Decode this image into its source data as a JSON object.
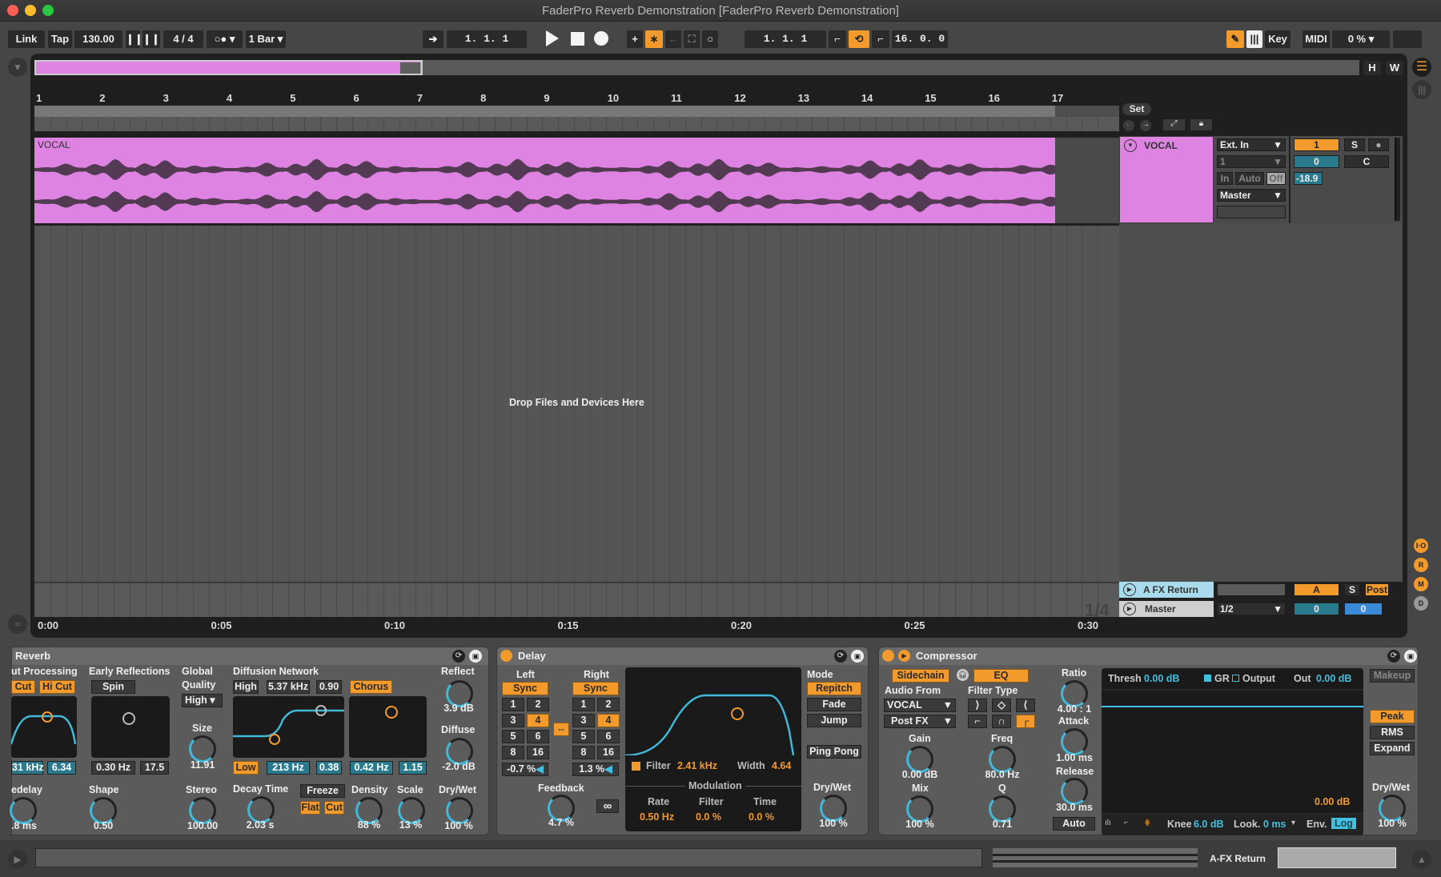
{
  "window": {
    "title": "FaderPro Reverb Demonstration  [FaderPro Reverb Demonstration]"
  },
  "transport": {
    "link": "Link",
    "tap": "Tap",
    "tempo": "130.00",
    "time_signature": "4 / 4",
    "quantize": "1 Bar",
    "metronome_icon": "metronome-icon",
    "position": "1.  1.  1",
    "loop_start": "1.  1.  1",
    "loop_length": "16.  0.  0",
    "key": "Key",
    "midi": "MIDI",
    "cpu": "0 %",
    "colors": {
      "accent": "#f39a2c"
    }
  },
  "overview": {
    "h_button": "H",
    "w_button": "W"
  },
  "arrangement": {
    "bar_numbers": [
      "1",
      "2",
      "3",
      "4",
      "5",
      "6",
      "7",
      "8",
      "9",
      "10",
      "11",
      "12",
      "13",
      "14",
      "15",
      "16",
      "17"
    ],
    "time_labels": [
      "0:00",
      "0:05",
      "0:10",
      "0:15",
      "0:20",
      "0:25",
      "0:30"
    ],
    "drop_text": "Drop Files and Devices Here",
    "grid_fraction": "1/4",
    "clip": {
      "name": "VOCAL",
      "color": "#de83e2"
    },
    "set_button": "Set"
  },
  "tracks": [
    {
      "name": "VOCAL",
      "input_type": "Ext. In",
      "input_channel": "1",
      "monitor": [
        "In",
        "Auto",
        "Off"
      ],
      "output": "Master",
      "number": "1",
      "solo": "S",
      "volume": "0",
      "pan": "C",
      "meter_value": "-18.9",
      "color": "#de83e2"
    },
    {
      "name": "A FX Return",
      "send": "A",
      "solo": "S",
      "post": "Post",
      "color": "#a8dcec"
    },
    {
      "name": "Master",
      "output": "1/2",
      "volume": "0",
      "pan": "0",
      "color": "#cfcfcf"
    }
  ],
  "side_buttons": [
    "I·O",
    "R",
    "M",
    "D"
  ],
  "devices": {
    "reverb": {
      "title": "Reverb",
      "input_processing": "ut Processing",
      "lo_cut": "Cut",
      "hi_cut": "Hi Cut",
      "freq": "31 kHz",
      "width": "6.34",
      "early_reflections": "Early Reflections",
      "spin": "Spin",
      "er_rate": "0.30 Hz",
      "er_amount": "17.5",
      "global": "Global",
      "quality_label": "Quality",
      "quality": "High",
      "size_label": "Size",
      "size": "11.91",
      "diffusion": "Diffusion Network",
      "high": "High",
      "high_freq": "5.37 kHz",
      "high_amt": "0.90",
      "chorus": "Chorus",
      "low": "Low",
      "low_freq": "213 Hz",
      "low_amt": "0.38",
      "chorus_rate": "0.42 Hz",
      "chorus_amt": "1.15",
      "reflect_label": "Reflect",
      "reflect": "3.9 dB",
      "diffuse_label": "Diffuse",
      "diffuse": "-2.0 dB",
      "predelay_label": "edelay",
      "predelay": ".8 ms",
      "shape_label": "Shape",
      "shape": "0.50",
      "stereo_label": "Stereo",
      "stereo": "100.00",
      "decay_label": "Decay Time",
      "decay": "2.03 s",
      "freeze": "Freeze",
      "flat": "Flat",
      "cut": "Cut",
      "density_label": "Density",
      "density": "88 %",
      "scale_label": "Scale",
      "scale": "13 %",
      "drywet_label": "Dry/Wet",
      "drywet": "100 %"
    },
    "delay": {
      "title": "Delay",
      "left": "Left",
      "right": "Right",
      "sync": "Sync",
      "divisions": [
        "1",
        "2",
        "3",
        "4",
        "5",
        "6",
        "8",
        "16"
      ],
      "selected_division": "4",
      "left_offset": "-0.7 %",
      "right_offset": "1.3 %",
      "feedback_label": "Feedback",
      "feedback": "4.7 %",
      "filter_label": "Filter",
      "filter": "2.41 kHz",
      "width_label": "Width",
      "width": "4.64",
      "modulation": "Modulation",
      "rate_label": "Rate",
      "rate": "0.50 Hz",
      "mod_filter_label": "Filter",
      "mod_filter": "0.0 %",
      "time_label": "Time",
      "time": "0.0 %",
      "mode": "Mode",
      "modes": [
        "Repitch",
        "Fade",
        "Jump"
      ],
      "ping_pong": "Ping Pong",
      "drywet_label": "Dry/Wet",
      "drywet": "100 %"
    },
    "compressor": {
      "title": "Compressor",
      "sidechain": "Sidechain",
      "eq": "EQ",
      "audio_from": "Audio From",
      "source": "VOCAL",
      "tap": "Post FX",
      "gain_label": "Gain",
      "gain": "0.00 dB",
      "mix_label": "Mix",
      "mix": "100 %",
      "filter_type": "Filter Type",
      "freq_label": "Freq",
      "freq": "80.0 Hz",
      "q_label": "Q",
      "q": "0.71",
      "ratio_label": "Ratio",
      "ratio": "4.00 : 1",
      "attack_label": "Attack",
      "attack": "1.00 ms",
      "release_label": "Release",
      "release": "30.0 ms",
      "auto": "Auto",
      "thresh_label": "Thresh",
      "thresh": "0.00 dB",
      "gr": "GR",
      "output": "Output",
      "out_label": "Out",
      "out": "0.00 dB",
      "gr_readout": "0.00 dB",
      "knee_label": "Knee",
      "knee": "6.0 dB",
      "look_label": "Look.",
      "look": "0 ms",
      "env_label": "Env.",
      "env": "Log",
      "makeup": "Makeup",
      "peak": "Peak",
      "rms": "RMS",
      "expand": "Expand",
      "drywet_label": "Dry/Wet",
      "drywet": "100 %"
    }
  },
  "statusbar": {
    "selected_track": "A-FX Return"
  }
}
